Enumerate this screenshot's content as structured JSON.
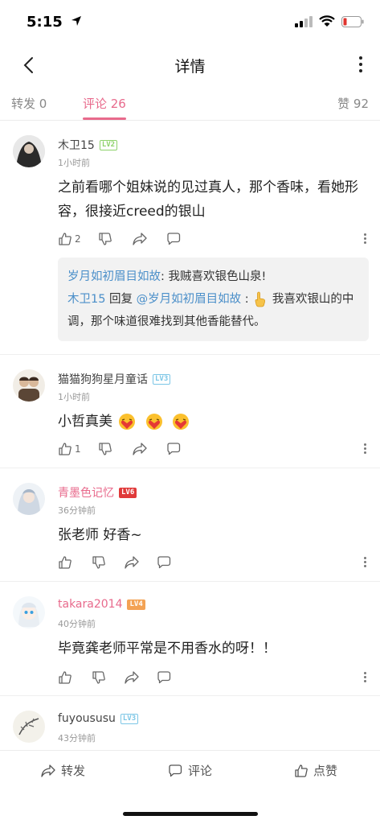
{
  "status": {
    "time": "5:15"
  },
  "nav": {
    "title": "详情"
  },
  "tabs": {
    "repost": "转发 0",
    "comment": "评论 26",
    "like": "赞 92"
  },
  "comments": [
    {
      "name": "木卫15",
      "level": "LV2",
      "time": "1小时前",
      "text": "之前看哪个姐妹说的见过真人，那个香味，看她形容，很接近creed的银山",
      "likes": "2",
      "replies": {
        "r1_user": "岁月如初眉目如故",
        "r1_text": ": 我贼喜欢银色山泉!",
        "r2_user": "木卫15",
        "r2_mid": " 回复 ",
        "r2_target": "@岁月如初眉目如故",
        "r2_sep": " : ",
        "r2_text": " 我喜欢银山的中调，那个味道很难找到其他香能替代。"
      }
    },
    {
      "name": "猫猫狗狗星月童话",
      "level": "LV3",
      "time": "1小时前",
      "text": "小哲真美",
      "likes": "1"
    },
    {
      "name": "青墨色记忆",
      "level": "LV6",
      "time": "36分钟前",
      "text": "张老师 好香~",
      "likes": ""
    },
    {
      "name": "takara2014",
      "level": "LV4",
      "time": "40分钟前",
      "text": "毕竟龚老师平常是不用香水的呀！！",
      "likes": ""
    },
    {
      "name": "fuyoususu",
      "level": "LV3",
      "time": "43分钟前",
      "text": "",
      "likes": ""
    }
  ],
  "bottom": {
    "repost": "转发",
    "comment": "评论",
    "like": "点赞"
  },
  "colors": {
    "accent": "#e86a8c",
    "link": "#4b8fc9"
  }
}
